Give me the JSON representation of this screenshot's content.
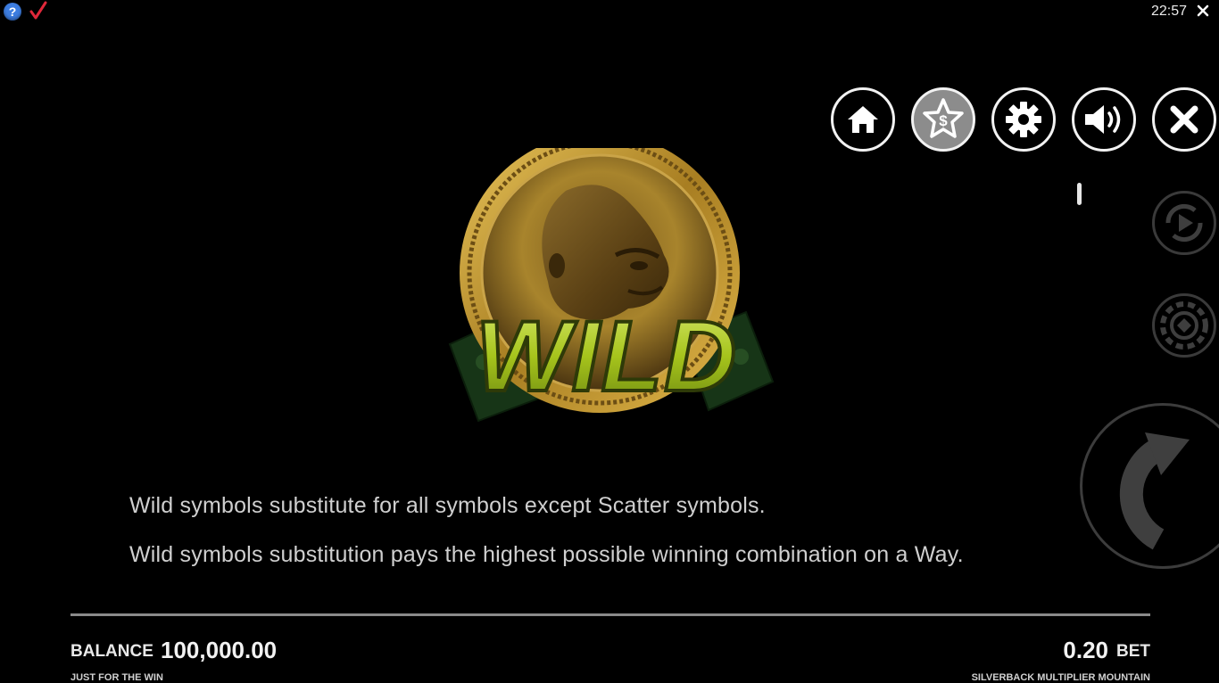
{
  "topbar": {
    "help_icon": "question-mark",
    "check_icon": "checkmark",
    "clock": "22:57",
    "close_icon": "x"
  },
  "menu": {
    "buttons": [
      {
        "name": "home",
        "icon": "home-icon"
      },
      {
        "name": "paytable",
        "icon": "star-dollar-icon",
        "active": true
      },
      {
        "name": "settings",
        "icon": "gear-icon"
      },
      {
        "name": "sound",
        "icon": "speaker-icon"
      },
      {
        "name": "close",
        "icon": "x-icon"
      }
    ]
  },
  "symbol": {
    "label": "WILD",
    "icon": "gorilla-coin-wild"
  },
  "paytable": {
    "rule_1": "Wild symbols substitute for all symbols except Scatter symbols.",
    "rule_2": "Wild symbols substitution pays the highest possible winning combination on a Way."
  },
  "footer": {
    "balance_label": "BALANCE",
    "balance_value": "100,000.00",
    "bet_value": "0.20",
    "bet_label": "BET",
    "left_caption": "JUST FOR THE WIN",
    "right_caption": "SILVERBACK MULTIPLIER MOUNTAIN"
  },
  "colors": {
    "background": "#000000",
    "accent_gold": "#c9a53a",
    "wild_green": "#a8c820",
    "help_blue": "#3d7de0",
    "check_red": "#e0283a"
  }
}
